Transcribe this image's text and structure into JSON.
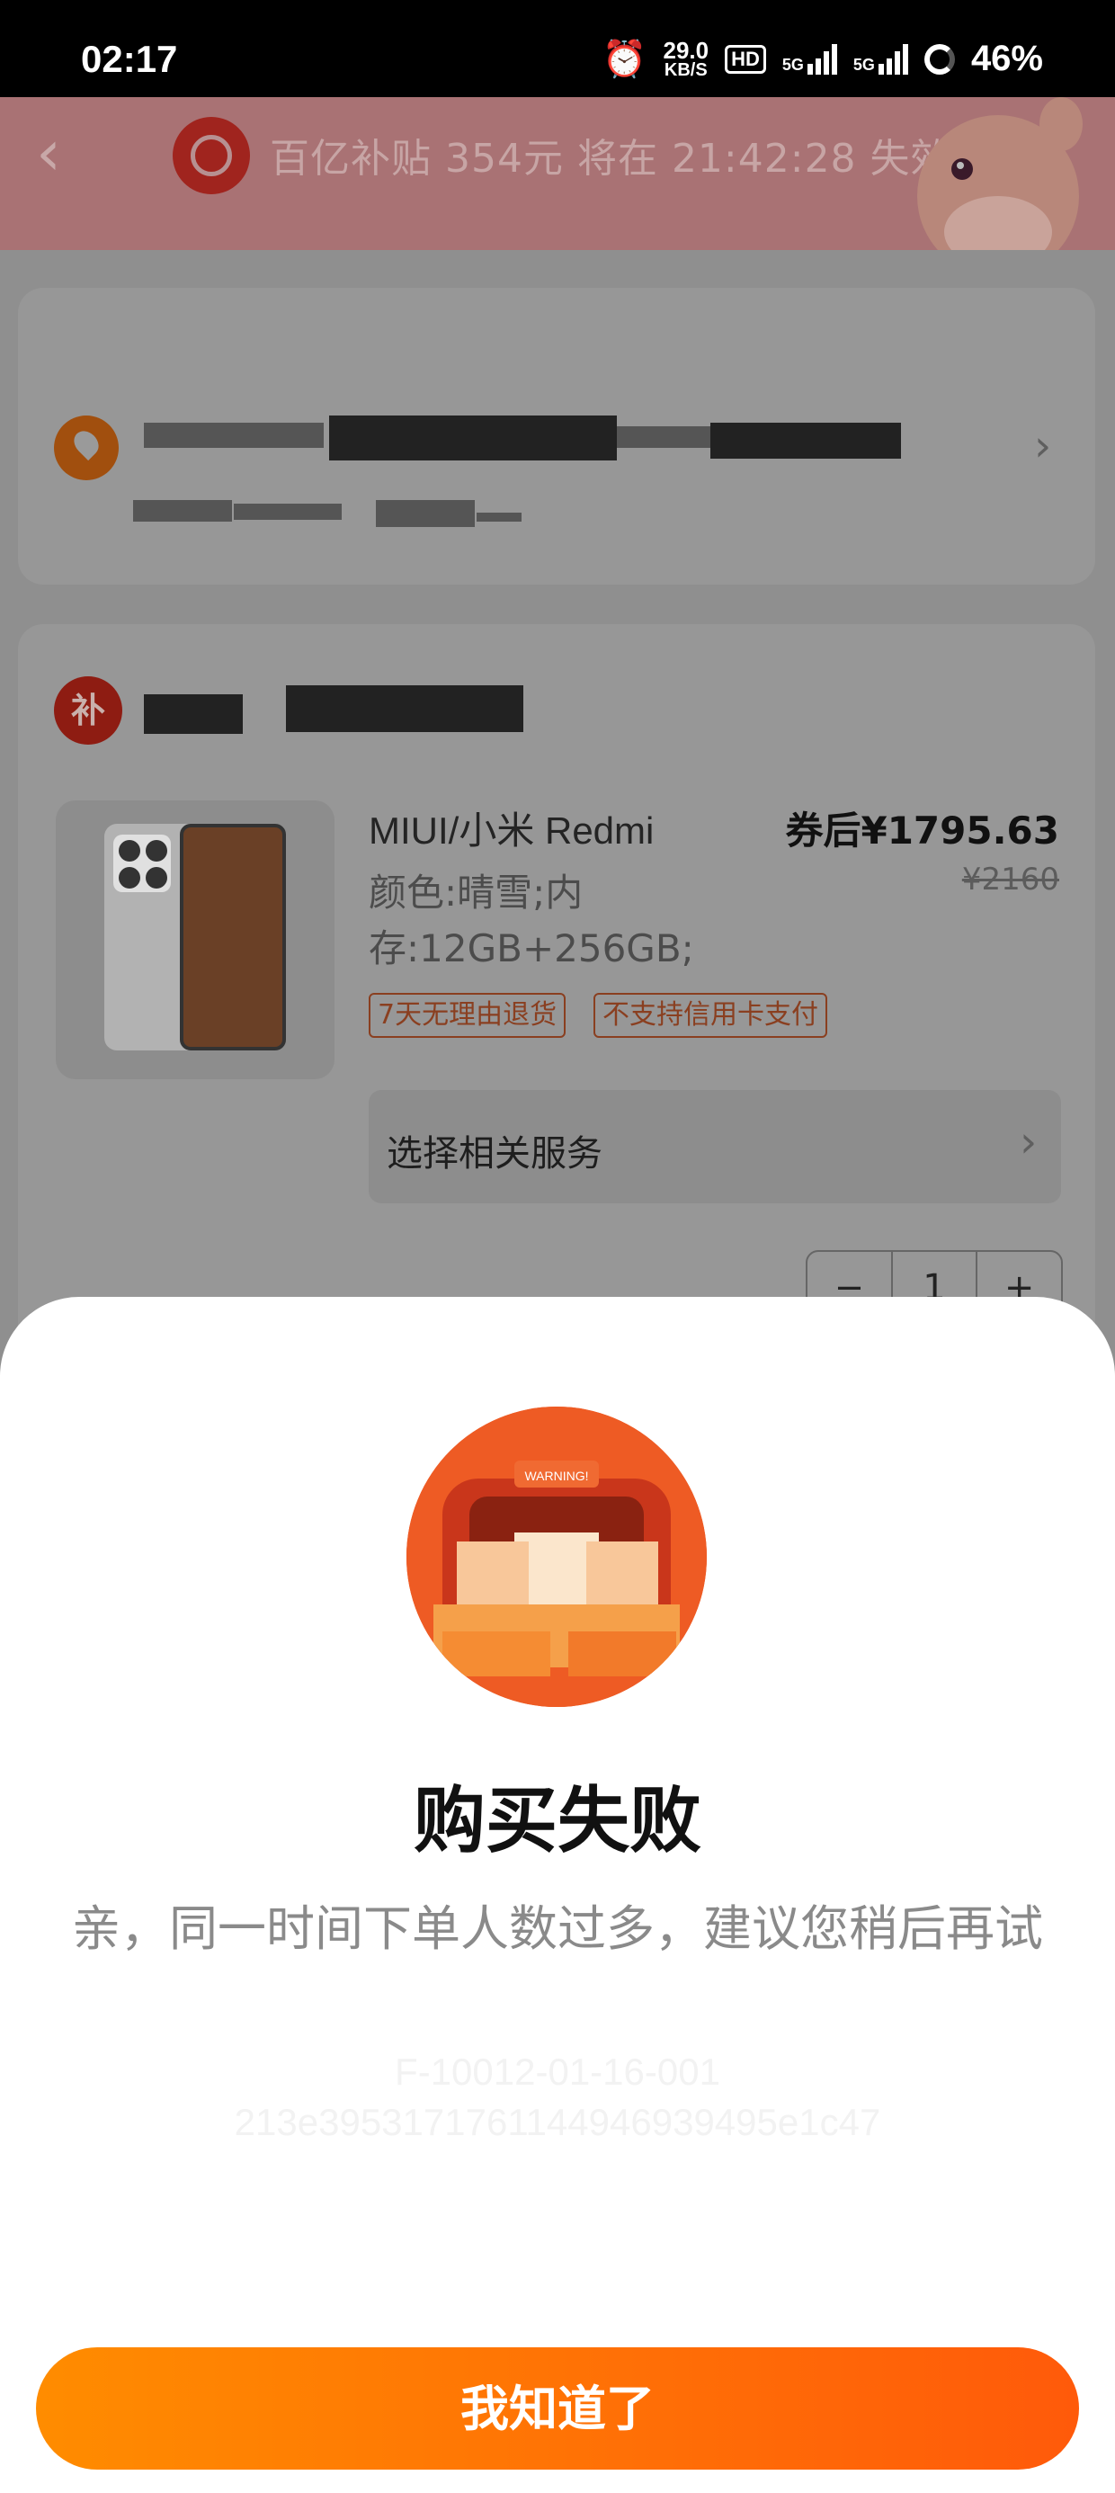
{
  "status_bar": {
    "time": "02:17",
    "speed_value": "29.0",
    "speed_unit": "KB/S",
    "hd_label": "HD",
    "network1": "5G",
    "network2": "5G",
    "battery": "46%"
  },
  "banner": {
    "text": "百亿补贴 354元 将在 21:42:28 失效"
  },
  "product": {
    "badge": "补",
    "title": "MIUI/小米 Redmi",
    "attributes": "颜色:晴雪;内存:12GB+256GB;",
    "price": "券后¥1795.63",
    "original_price": "¥2160",
    "tags": [
      "7天无理由退货",
      "不支持信用卡支付"
    ],
    "service_label": "选择相关服务",
    "quantity": "1",
    "minus": "−",
    "plus": "+"
  },
  "dialog": {
    "image_label": "WARNING!",
    "title": "购买失败",
    "message": "亲，同一时间下单人数过多，建议您稍后再试",
    "error_code": "F-10012-01-16-001",
    "trace_id": "213e3953171761144946939495e1c47",
    "button": "我知道了"
  },
  "colors": {
    "accent_start": "#ff8c00",
    "accent_end": "#ff5a0a",
    "warning_bg": "#ee5b24"
  }
}
